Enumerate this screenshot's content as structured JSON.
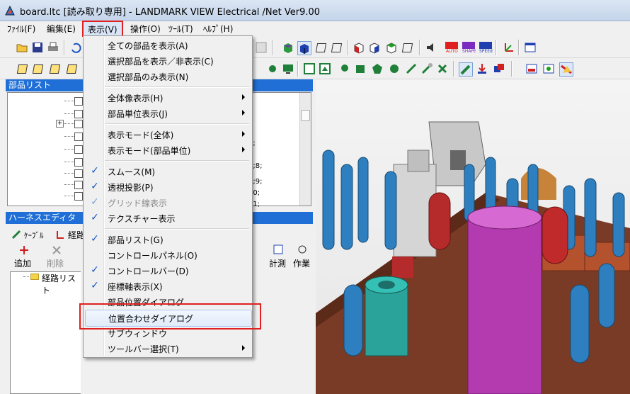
{
  "window": {
    "title": "board.ltc [読み取り専用] - LANDMARK VIEW Electrical /Net Ver9.00"
  },
  "menubar": [
    "ﾌｧｲﾙ(F)",
    "編集(E)",
    "表示(V)",
    "操作(O)",
    "ﾂｰﾙ(T)",
    "ﾍﾙﾌﾟ(H)"
  ],
  "parts_panel": {
    "title": "部品リスト"
  },
  "harness_panel": {
    "title": "ハーネスエディタ",
    "tabs": [
      "ｹｰﾌﾞﾙ",
      "経路"
    ],
    "buttons": [
      {
        "label": "追加"
      },
      {
        "label": "削除"
      }
    ],
    "tree_root": "経路リスト"
  },
  "right_buttons": [
    "計測",
    "作業"
  ],
  "tree_fragments": [
    "5;",
    "0;8;",
    "0;9;",
    "10;",
    "11;"
  ],
  "view_menu": {
    "items": [
      {
        "label": "全ての部品を表示(A)",
        "checked": false,
        "submenu": false,
        "disabled": false
      },
      {
        "label": "選択部品を表示／非表示(C)",
        "checked": false,
        "submenu": false,
        "disabled": false
      },
      {
        "label": "選択部品のみ表示(N)",
        "checked": false,
        "submenu": false,
        "disabled": false
      },
      {
        "sep": true
      },
      {
        "label": "全体像表示(H)",
        "checked": false,
        "submenu": true,
        "disabled": false
      },
      {
        "label": "部品単位表示(J)",
        "checked": false,
        "submenu": true,
        "disabled": false
      },
      {
        "sep": true
      },
      {
        "label": "表示モード(全体)",
        "checked": false,
        "submenu": true,
        "disabled": false
      },
      {
        "label": "表示モード(部品単位)",
        "checked": false,
        "submenu": true,
        "disabled": false
      },
      {
        "sep": true
      },
      {
        "label": "スムース(M)",
        "checked": true,
        "submenu": false,
        "disabled": false
      },
      {
        "label": "透視投影(P)",
        "checked": true,
        "submenu": false,
        "disabled": false
      },
      {
        "label": "グリッド線表示",
        "checked": true,
        "submenu": false,
        "disabled": true
      },
      {
        "label": "テクスチャー表示",
        "checked": true,
        "submenu": false,
        "disabled": false
      },
      {
        "sep": true
      },
      {
        "label": "部品リスト(G)",
        "checked": true,
        "submenu": false,
        "disabled": false
      },
      {
        "label": "コントロールパネル(O)",
        "checked": false,
        "submenu": false,
        "disabled": false
      },
      {
        "label": "コントロールバー(D)",
        "checked": true,
        "submenu": false,
        "disabled": false
      },
      {
        "label": "座標軸表示(X)",
        "checked": true,
        "submenu": false,
        "disabled": false
      },
      {
        "label": "部品位置ダイアログ",
        "checked": false,
        "submenu": false,
        "disabled": false
      },
      {
        "label": "位置合わせダイアログ",
        "checked": false,
        "submenu": false,
        "disabled": false,
        "highlighted": true
      },
      {
        "label": "サブウィンドウ",
        "checked": false,
        "submenu": false,
        "disabled": false
      },
      {
        "label": "ツールバー選択(T)",
        "checked": false,
        "submenu": true,
        "disabled": false
      }
    ]
  },
  "colors": {
    "accent": "#1f6fd6",
    "highlight_border": "#e02020"
  },
  "icons": [
    "open-folder-icon",
    "save-icon",
    "print-icon",
    "cube-icon",
    "camera-icon",
    "zoom-icon"
  ]
}
